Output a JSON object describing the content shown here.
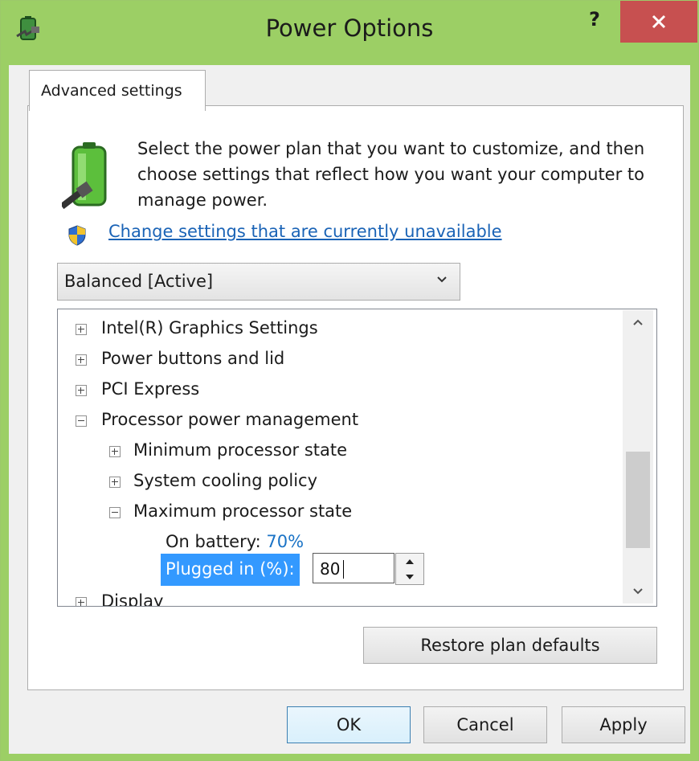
{
  "window": {
    "title": "Power Options",
    "help_label": "?",
    "close_label": "×"
  },
  "tabs": [
    {
      "label": "Advanced settings"
    }
  ],
  "description": "Select the power plan that you want to customize, and then choose settings that reflect how you want your computer to manage power.",
  "link": {
    "label": "Change settings that are currently unavailable"
  },
  "plan_select": {
    "value": "Balanced [Active]"
  },
  "tree": {
    "items": [
      {
        "label": "Intel(R) Graphics Settings",
        "state": "collapsed"
      },
      {
        "label": "Power buttons and lid",
        "state": "collapsed"
      },
      {
        "label": "PCI Express",
        "state": "collapsed"
      },
      {
        "label": "Processor power management",
        "state": "expanded"
      },
      {
        "label": "Minimum processor state",
        "state": "collapsed"
      },
      {
        "label": "System cooling policy",
        "state": "collapsed"
      },
      {
        "label": "Maximum processor state",
        "state": "expanded"
      },
      {
        "label": "Display",
        "state": "collapsed"
      }
    ],
    "on_battery": {
      "label": "On battery:",
      "value": "70%"
    },
    "plugged_in": {
      "label": "Plugged in (%):",
      "value": "80"
    }
  },
  "buttons": {
    "restore": "Restore plan defaults",
    "ok": "OK",
    "cancel": "Cancel",
    "apply": "Apply"
  },
  "colors": {
    "title_bar": "#9ccf65",
    "close_button": "#c75050",
    "link": "#1a63b6",
    "selection": "#3399ff",
    "battery_value": "#1a73c6"
  }
}
